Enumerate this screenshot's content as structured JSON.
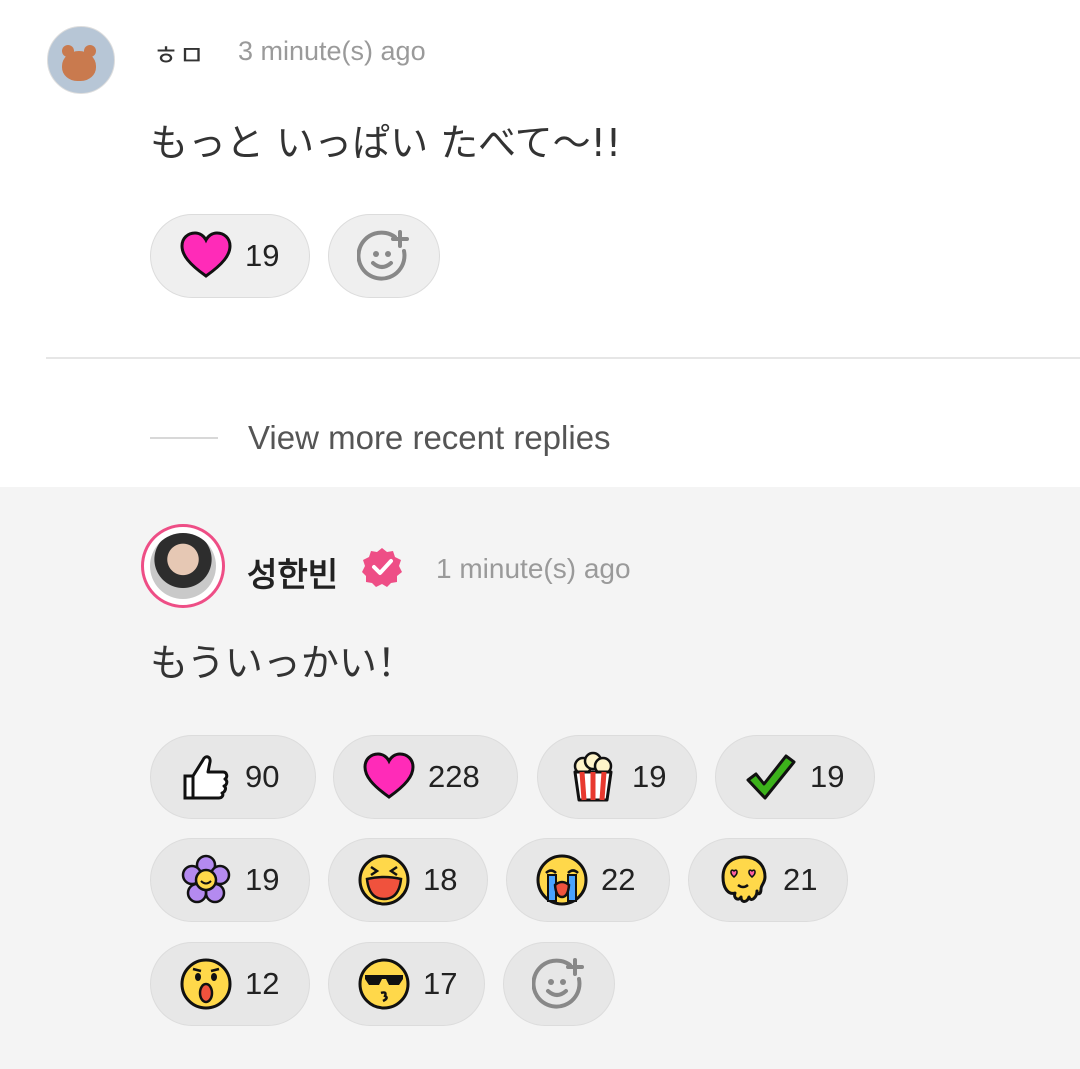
{
  "comment1": {
    "author": "ㅎㅁ",
    "time": "3 minute(s) ago",
    "text": "もっと いっぱい たべて〜!!",
    "reactions": [
      {
        "icon": "heart-icon",
        "count": "19"
      }
    ]
  },
  "more_replies_label": "View more recent replies",
  "comment2": {
    "author": "성한빈",
    "time": "1 minute(s) ago",
    "text": "もういっかい！",
    "reactions": [
      {
        "icon": "thumbs-up-icon",
        "count": "90"
      },
      {
        "icon": "heart-icon",
        "count": "228"
      },
      {
        "icon": "popcorn-icon",
        "count": "19"
      },
      {
        "icon": "checkmark-icon",
        "count": "19"
      },
      {
        "icon": "flower-icon",
        "count": "19"
      },
      {
        "icon": "laughing-face-icon",
        "count": "18"
      },
      {
        "icon": "crying-face-icon",
        "count": "22"
      },
      {
        "icon": "heart-eyes-melting-face-icon",
        "count": "21"
      },
      {
        "icon": "surprised-face-icon",
        "count": "12"
      },
      {
        "icon": "sunglasses-kiss-face-icon",
        "count": "17"
      }
    ]
  },
  "colors": {
    "heart": "#ff2bb8",
    "verified": "#ee4e86",
    "check": "#3cb21b",
    "flower": "#b48af0",
    "emoji_yellow": "#ffd84a"
  }
}
